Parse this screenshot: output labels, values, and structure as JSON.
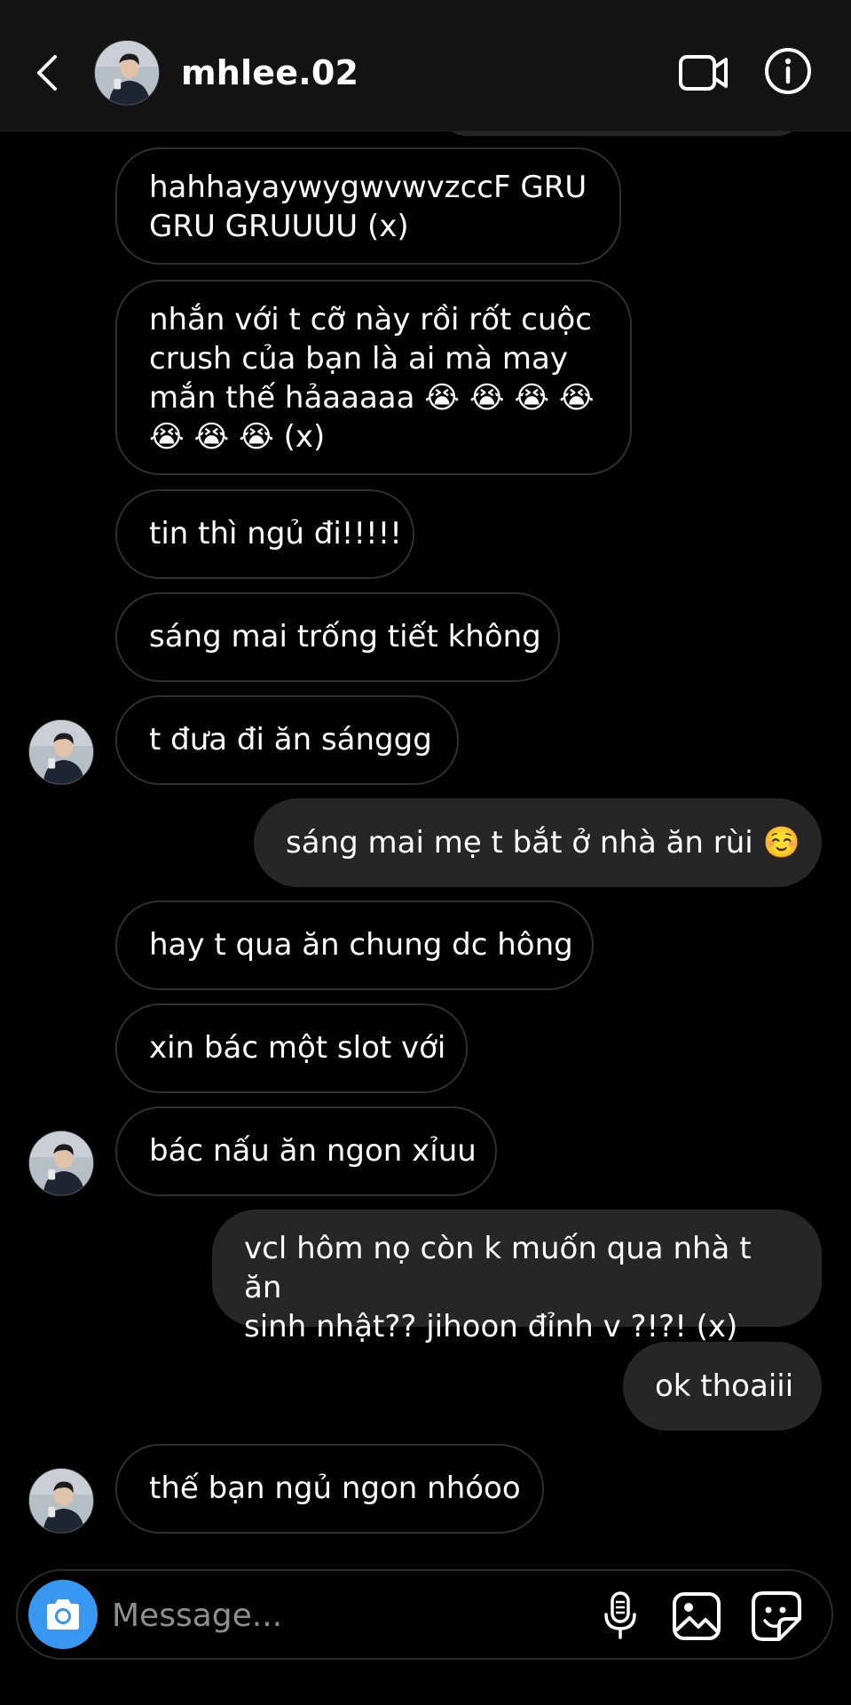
{
  "header": {
    "username": "mhlee.02",
    "back_icon": "chevron-left-icon",
    "video_icon": "video-camera-icon",
    "info_icon": "info-icon"
  },
  "messages": [
    {
      "from": "them",
      "text": "hahhayaywygwvwvzccF GRU\nGRU GRUUUU (x)"
    },
    {
      "from": "them",
      "text": "nhắn với t cỡ này rồi rốt cuộc\ncrush của bạn là ai mà may\nmắn thế hảaaaaa 😭 😭 😭 😭\n😭 😭 😭 (x)"
    },
    {
      "from": "them",
      "text": "tin thì ngủ đi!!!!!"
    },
    {
      "from": "them",
      "text": "sáng mai trống tiết không"
    },
    {
      "from": "them",
      "text": "t đưa đi ăn sánggg"
    },
    {
      "from": "me",
      "text": "sáng mai mẹ t bắt ở nhà ăn rùi ☺️"
    },
    {
      "from": "them",
      "text": "hay t qua ăn chung dc hông"
    },
    {
      "from": "them",
      "text": "xin bác một slot với"
    },
    {
      "from": "them",
      "text": "bác nấu ăn ngon xỉuu"
    },
    {
      "from": "me",
      "text": "vcl hôm nọ còn k muốn qua nhà t ăn\nsinh nhật?? jihoon đỉnh v ?!?! (x)"
    },
    {
      "from": "me",
      "text": "ok thoaiii"
    },
    {
      "from": "them",
      "text": "thế bạn ngủ ngon nhóoo"
    }
  ],
  "composer": {
    "placeholder": "Message...",
    "camera_icon": "camera-icon",
    "mic_icon": "microphone-icon",
    "gallery_icon": "gallery-icon",
    "sticker_icon": "sticker-icon"
  },
  "colors": {
    "background": "#000000",
    "header_bg": "#131313",
    "incoming_border": "#2f2f2f",
    "outgoing_bg": "#262626",
    "camera_button": "#3897f0",
    "placeholder": "#8e8e8e"
  }
}
